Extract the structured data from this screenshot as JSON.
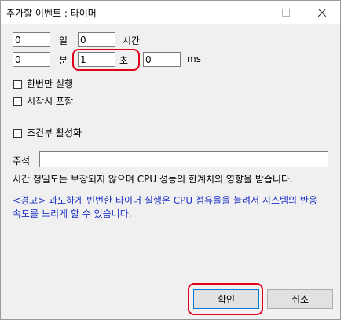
{
  "window": {
    "title": "추가할 이벤트 : 타이머"
  },
  "timer": {
    "days_value": "0",
    "days_label": "일",
    "hours_value": "0",
    "hours_label": "시간",
    "minutes_value": "0",
    "minutes_label": "분",
    "seconds_value": "1",
    "seconds_label": "초",
    "ms_value": "0",
    "ms_label": "ms"
  },
  "options": {
    "run_once_label": "한번만 실행",
    "run_once_checked": false,
    "include_at_start_label": "시작시 포함",
    "include_at_start_checked": false,
    "conditional_label": "조건부 활성화",
    "conditional_checked": false
  },
  "comment": {
    "label": "주석",
    "value": ""
  },
  "notes": {
    "precision": "시간 정밀도는 보장되지 않으며 CPU 성능의 한계치의 영향을 받습니다.",
    "warning": "<경고> 과도하게 빈번한 타이머 실행은 CPU 점유율을 늘려서 시스템의 반응 속도를 느리게 할 수 있습니다."
  },
  "buttons": {
    "ok_label": "확인",
    "cancel_label": "취소"
  },
  "colors": {
    "highlight": "#e3001b",
    "warning_text": "#1a2fc4"
  }
}
